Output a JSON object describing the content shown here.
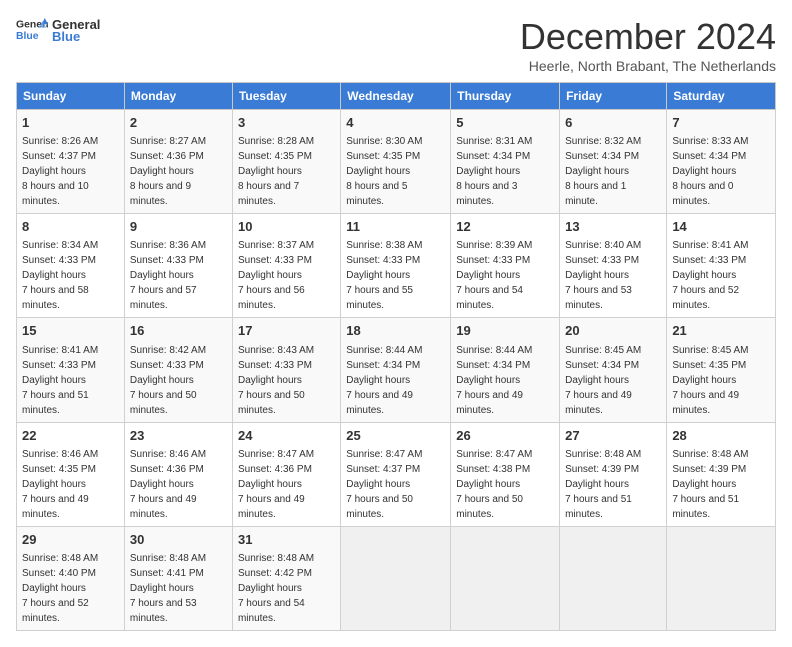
{
  "header": {
    "logo_general": "General",
    "logo_blue": "Blue",
    "month_title": "December 2024",
    "location": "Heerle, North Brabant, The Netherlands"
  },
  "weekdays": [
    "Sunday",
    "Monday",
    "Tuesday",
    "Wednesday",
    "Thursday",
    "Friday",
    "Saturday"
  ],
  "weeks": [
    [
      {
        "day": "1",
        "sunrise": "8:26 AM",
        "sunset": "4:37 PM",
        "daylight": "8 hours and 10 minutes."
      },
      {
        "day": "2",
        "sunrise": "8:27 AM",
        "sunset": "4:36 PM",
        "daylight": "8 hours and 9 minutes."
      },
      {
        "day": "3",
        "sunrise": "8:28 AM",
        "sunset": "4:35 PM",
        "daylight": "8 hours and 7 minutes."
      },
      {
        "day": "4",
        "sunrise": "8:30 AM",
        "sunset": "4:35 PM",
        "daylight": "8 hours and 5 minutes."
      },
      {
        "day": "5",
        "sunrise": "8:31 AM",
        "sunset": "4:34 PM",
        "daylight": "8 hours and 3 minutes."
      },
      {
        "day": "6",
        "sunrise": "8:32 AM",
        "sunset": "4:34 PM",
        "daylight": "8 hours and 1 minute."
      },
      {
        "day": "7",
        "sunrise": "8:33 AM",
        "sunset": "4:34 PM",
        "daylight": "8 hours and 0 minutes."
      }
    ],
    [
      {
        "day": "8",
        "sunrise": "8:34 AM",
        "sunset": "4:33 PM",
        "daylight": "7 hours and 58 minutes."
      },
      {
        "day": "9",
        "sunrise": "8:36 AM",
        "sunset": "4:33 PM",
        "daylight": "7 hours and 57 minutes."
      },
      {
        "day": "10",
        "sunrise": "8:37 AM",
        "sunset": "4:33 PM",
        "daylight": "7 hours and 56 minutes."
      },
      {
        "day": "11",
        "sunrise": "8:38 AM",
        "sunset": "4:33 PM",
        "daylight": "7 hours and 55 minutes."
      },
      {
        "day": "12",
        "sunrise": "8:39 AM",
        "sunset": "4:33 PM",
        "daylight": "7 hours and 54 minutes."
      },
      {
        "day": "13",
        "sunrise": "8:40 AM",
        "sunset": "4:33 PM",
        "daylight": "7 hours and 53 minutes."
      },
      {
        "day": "14",
        "sunrise": "8:41 AM",
        "sunset": "4:33 PM",
        "daylight": "7 hours and 52 minutes."
      }
    ],
    [
      {
        "day": "15",
        "sunrise": "8:41 AM",
        "sunset": "4:33 PM",
        "daylight": "7 hours and 51 minutes."
      },
      {
        "day": "16",
        "sunrise": "8:42 AM",
        "sunset": "4:33 PM",
        "daylight": "7 hours and 50 minutes."
      },
      {
        "day": "17",
        "sunrise": "8:43 AM",
        "sunset": "4:33 PM",
        "daylight": "7 hours and 50 minutes."
      },
      {
        "day": "18",
        "sunrise": "8:44 AM",
        "sunset": "4:34 PM",
        "daylight": "7 hours and 49 minutes."
      },
      {
        "day": "19",
        "sunrise": "8:44 AM",
        "sunset": "4:34 PM",
        "daylight": "7 hours and 49 minutes."
      },
      {
        "day": "20",
        "sunrise": "8:45 AM",
        "sunset": "4:34 PM",
        "daylight": "7 hours and 49 minutes."
      },
      {
        "day": "21",
        "sunrise": "8:45 AM",
        "sunset": "4:35 PM",
        "daylight": "7 hours and 49 minutes."
      }
    ],
    [
      {
        "day": "22",
        "sunrise": "8:46 AM",
        "sunset": "4:35 PM",
        "daylight": "7 hours and 49 minutes."
      },
      {
        "day": "23",
        "sunrise": "8:46 AM",
        "sunset": "4:36 PM",
        "daylight": "7 hours and 49 minutes."
      },
      {
        "day": "24",
        "sunrise": "8:47 AM",
        "sunset": "4:36 PM",
        "daylight": "7 hours and 49 minutes."
      },
      {
        "day": "25",
        "sunrise": "8:47 AM",
        "sunset": "4:37 PM",
        "daylight": "7 hours and 50 minutes."
      },
      {
        "day": "26",
        "sunrise": "8:47 AM",
        "sunset": "4:38 PM",
        "daylight": "7 hours and 50 minutes."
      },
      {
        "day": "27",
        "sunrise": "8:48 AM",
        "sunset": "4:39 PM",
        "daylight": "7 hours and 51 minutes."
      },
      {
        "day": "28",
        "sunrise": "8:48 AM",
        "sunset": "4:39 PM",
        "daylight": "7 hours and 51 minutes."
      }
    ],
    [
      {
        "day": "29",
        "sunrise": "8:48 AM",
        "sunset": "4:40 PM",
        "daylight": "7 hours and 52 minutes."
      },
      {
        "day": "30",
        "sunrise": "8:48 AM",
        "sunset": "4:41 PM",
        "daylight": "7 hours and 53 minutes."
      },
      {
        "day": "31",
        "sunrise": "8:48 AM",
        "sunset": "4:42 PM",
        "daylight": "7 hours and 54 minutes."
      },
      null,
      null,
      null,
      null
    ]
  ]
}
